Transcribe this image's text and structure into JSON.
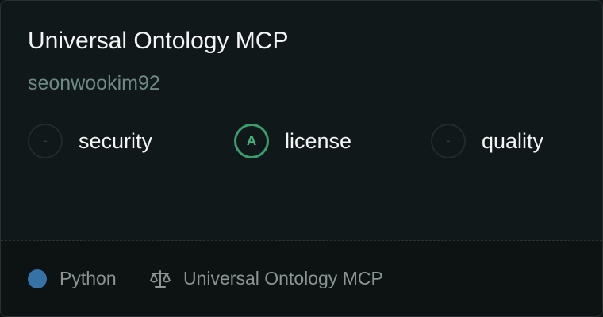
{
  "server": {
    "title": "Universal Ontology MCP",
    "author": "seonwookim92"
  },
  "scores": [
    {
      "label": "security",
      "grade": "-"
    },
    {
      "label": "license",
      "grade": "A"
    },
    {
      "label": "quality",
      "grade": "-"
    }
  ],
  "footer": {
    "language": "Python",
    "language_color": "#3572a5",
    "language_icon": "colored-dot",
    "license_icon": "scale-icon",
    "license_text": "Universal Ontology MCP"
  },
  "colors": {
    "grade_a": "#3a9d6d",
    "author": "#6f8a85"
  }
}
